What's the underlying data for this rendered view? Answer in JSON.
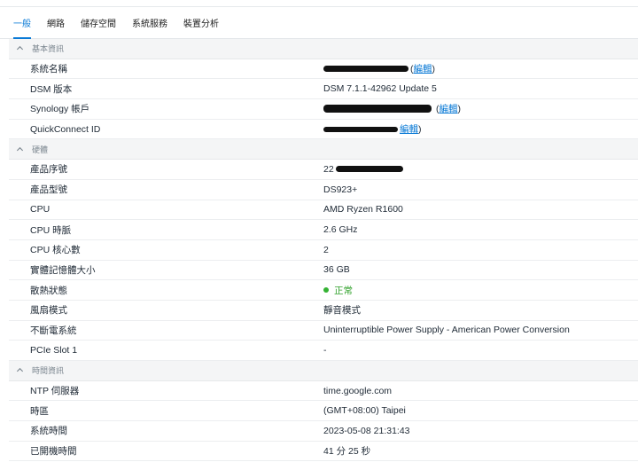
{
  "tabs": [
    "一般",
    "網路",
    "儲存空間",
    "系統服務",
    "裝置分析"
  ],
  "active_tab": "一般",
  "sections": {
    "basic": {
      "title": "基本資訊",
      "rows": {
        "name": {
          "label": "系統名稱",
          "value": "",
          "link": "編輯"
        },
        "dsm": {
          "label": "DSM 版本",
          "value": "DSM 7.1.1-42962 Update 5"
        },
        "account": {
          "label": "Synology 帳戶",
          "value": "",
          "link": "編輯"
        },
        "qc": {
          "label": "QuickConnect ID",
          "value": "",
          "link": "編輯"
        }
      }
    },
    "hardware": {
      "title": "硬體",
      "rows": {
        "serial": {
          "label": "產品序號",
          "value": "22"
        },
        "model": {
          "label": "產品型號",
          "value": "DS923+"
        },
        "cpu": {
          "label": "CPU",
          "value": "AMD Ryzen R1600"
        },
        "freq": {
          "label": "CPU 時脈",
          "value": "2.6 GHz"
        },
        "cores": {
          "label": "CPU 核心數",
          "value": "2"
        },
        "mem": {
          "label": "實體記憶體大小",
          "value": "36 GB"
        },
        "thermal": {
          "label": "散熱狀態",
          "value": "正常",
          "status_color": "#34b233"
        },
        "fan": {
          "label": "風扇模式",
          "value": "靜音模式"
        },
        "ups": {
          "label": "不斷電系統",
          "value": "Uninterruptible Power Supply - American Power Conversion"
        },
        "pcie": {
          "label": "PCIe Slot 1",
          "value": "-"
        }
      }
    },
    "time": {
      "title": "時間資訊",
      "rows": {
        "ntp": {
          "label": "NTP 伺服器",
          "value": "time.google.com"
        },
        "tz": {
          "label": "時區",
          "value": "(GMT+08:00) Taipei"
        },
        "systime": {
          "label": "系統時間",
          "value": "2023-05-08 21:31:43"
        },
        "uptime": {
          "label": "已開機時間",
          "value": "41 分 25 秒"
        }
      }
    }
  },
  "colors": {
    "accent": "#0a7ad6",
    "ok": "#34b233"
  }
}
